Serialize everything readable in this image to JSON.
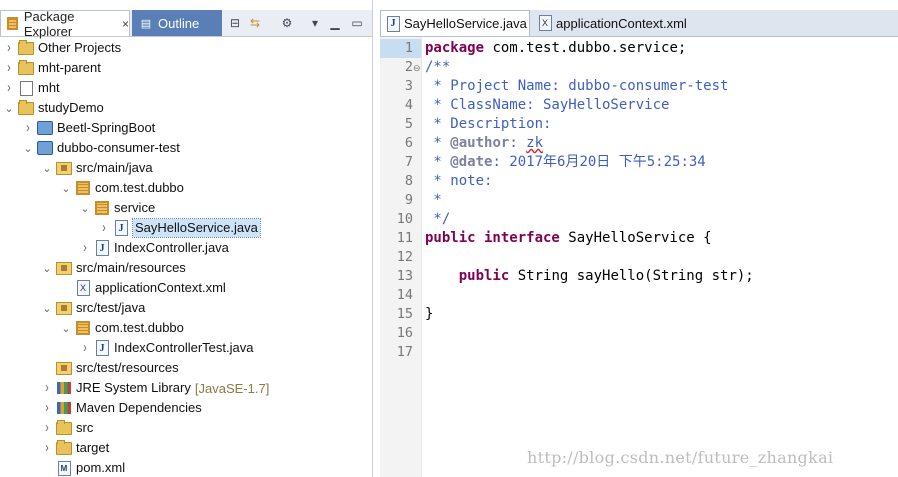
{
  "package_explorer": {
    "tab_label": "Package Explorer",
    "tab_close": "×",
    "outline_label": "Outline",
    "tree": [
      {
        "label": "Other Projects",
        "level": 0,
        "arrow": "closed",
        "icon": "folder"
      },
      {
        "label": "mht-parent",
        "level": 0,
        "arrow": "closed",
        "icon": "folder"
      },
      {
        "label": "mht",
        "level": 0,
        "arrow": "closed",
        "icon": "doc"
      },
      {
        "label": "studyDemo",
        "level": 0,
        "arrow": "open",
        "icon": "folder"
      },
      {
        "label": "Beetl-SpringBoot",
        "level": 1,
        "arrow": "closed",
        "icon": "project"
      },
      {
        "label": "dubbo-consumer-test",
        "level": 1,
        "arrow": "open",
        "icon": "project"
      },
      {
        "label": "src/main/java",
        "level": 2,
        "arrow": "open",
        "icon": "srcfolder"
      },
      {
        "label": "com.test.dubbo",
        "level": 3,
        "arrow": "open",
        "icon": "package"
      },
      {
        "label": "service",
        "level": 4,
        "arrow": "open",
        "icon": "package"
      },
      {
        "label": "SayHelloService.java",
        "level": 5,
        "arrow": "closed",
        "icon": "java",
        "selected": true
      },
      {
        "label": "IndexController.java",
        "level": 4,
        "arrow": "closed",
        "icon": "java"
      },
      {
        "label": "src/main/resources",
        "level": 2,
        "arrow": "open",
        "icon": "srcfolder"
      },
      {
        "label": "applicationContext.xml",
        "level": 3,
        "arrow": "none",
        "icon": "xml"
      },
      {
        "label": "src/test/java",
        "level": 2,
        "arrow": "open",
        "icon": "srcfolder"
      },
      {
        "label": "com.test.dubbo",
        "level": 3,
        "arrow": "open",
        "icon": "package"
      },
      {
        "label": "IndexControllerTest.java",
        "level": 4,
        "arrow": "closed",
        "icon": "java"
      },
      {
        "label": "src/test/resources",
        "level": 2,
        "arrow": "none",
        "icon": "srcfolder"
      },
      {
        "label": "JRE System Library",
        "suffix": "[JavaSE-1.7]",
        "level": 2,
        "arrow": "closed",
        "icon": "library"
      },
      {
        "label": "Maven Dependencies",
        "level": 2,
        "arrow": "closed",
        "icon": "library"
      },
      {
        "label": "src",
        "level": 2,
        "arrow": "closed",
        "icon": "folder"
      },
      {
        "label": "target",
        "level": 2,
        "arrow": "closed",
        "icon": "folder"
      },
      {
        "label": "pom.xml",
        "level": 2,
        "arrow": "none",
        "icon": "m"
      }
    ]
  },
  "editor": {
    "tabs": [
      {
        "label": "SayHelloService.java",
        "icon": "java",
        "active": true
      },
      {
        "label": "applicationContext.xml",
        "icon": "xml",
        "active": false
      }
    ],
    "line_numbers": [
      "1",
      "2",
      "3",
      "4",
      "5",
      "6",
      "7",
      "8",
      "9",
      "10",
      "11",
      "12",
      "13",
      "14",
      "15",
      "16",
      "17"
    ],
    "fold_marker": "⊖",
    "lines": {
      "l1_kw": "package",
      "l1_rest": " com.test.dubbo.service;",
      "l2": "/**",
      "l3": " * Project Name: dubbo-consumer-test",
      "l4": " * ClassName: SayHelloService",
      "l5": " * Description:",
      "l6_star": " * ",
      "l6_tag": "@author",
      "l6_colon": ": ",
      "l6_name": "zk",
      "l7_star": " * ",
      "l7_tag": "@date",
      "l7_rest": ": 2017年6月20日 下午5:25:34",
      "l8": " * note:",
      "l9": " *",
      "l10": " */",
      "l11_kw": "public interface",
      "l11_rest": " SayHelloService {",
      "l13_indent": "    ",
      "l13_kw": "public",
      "l13_rest": " String sayHello(String str);",
      "l15": "}"
    }
  },
  "watermark": "http://blog.csdn.net/future_zhangkai"
}
